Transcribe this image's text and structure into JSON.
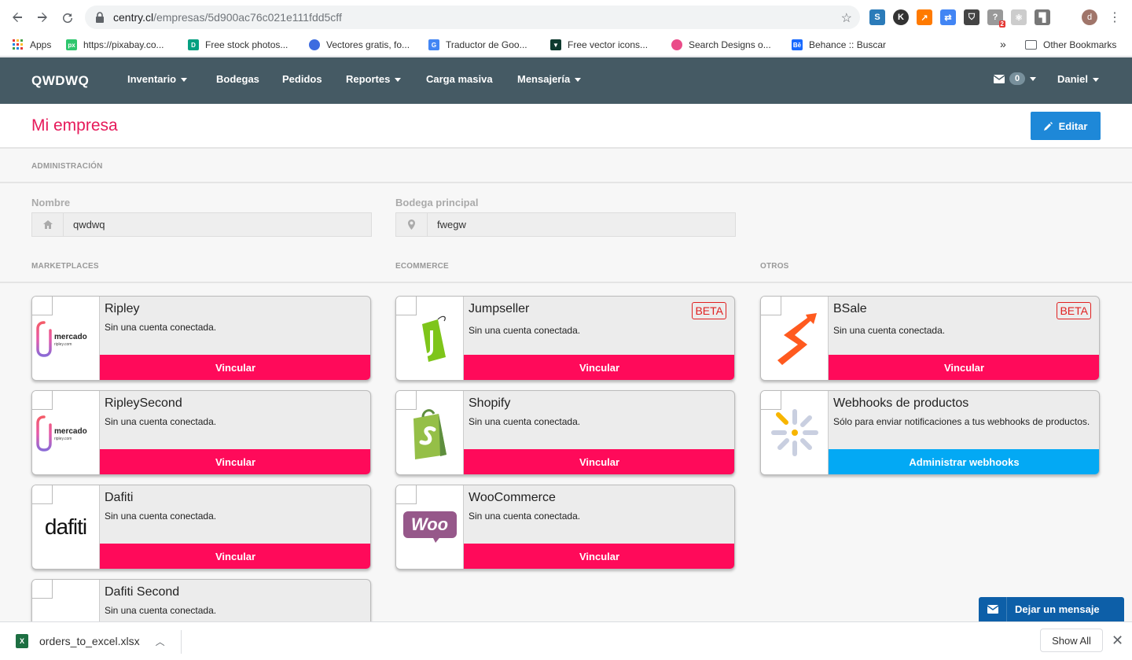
{
  "browser": {
    "url_host": "centry.cl",
    "url_path": "/empresas/5d900ac76c021e111fdd5cff",
    "profile_initial": "d",
    "ext_badge": "2"
  },
  "bookmarks": [
    {
      "label": "Apps",
      "color": "#e53935"
    },
    {
      "label": "https://pixabay.co...",
      "color": "#2ec66d",
      "icon_text": "px"
    },
    {
      "label": "Free stock photos...",
      "color": "#05a081",
      "icon_text": "D"
    },
    {
      "label": "Vectores gratis, fo...",
      "color": "#3d6ce0"
    },
    {
      "label": "Traductor de Goo...",
      "color": "#4285f4"
    },
    {
      "label": "Free vector icons...",
      "color": "#0e3a2f"
    },
    {
      "label": "Search Designs o...",
      "color": "#ea4c89"
    },
    {
      "label": "Behance :: Buscar",
      "color": "#1769ff",
      "icon_text": "Bē"
    }
  ],
  "bookmarks_overflow": "»",
  "other_bookmarks": "Other Bookmarks",
  "navbar": {
    "brand": "QWDWQ",
    "items": [
      "Inventario",
      "Bodegas",
      "Pedidos",
      "Reportes",
      "Carga masiva",
      "Mensajería"
    ],
    "mail_count": "0",
    "user": "Daniel"
  },
  "header": {
    "title": "Mi empresa",
    "edit_label": "Editar"
  },
  "sections": {
    "admin": "ADMINISTRACIÓN",
    "marketplaces": "MARKETPLACES",
    "ecommerce": "ECOMMERCE",
    "otros": "OTROS"
  },
  "form": {
    "nombre_label": "Nombre",
    "nombre_value": "qwdwq",
    "bodega_label": "Bodega principal",
    "bodega_value": "fwegw"
  },
  "cards": {
    "ripley": {
      "name": "Ripley",
      "desc": "Sin una cuenta conectada.",
      "action": "Vincular"
    },
    "ripley_second": {
      "name": "RipleySecond",
      "desc": "Sin una cuenta conectada.",
      "action": "Vincular"
    },
    "dafiti": {
      "name": "Dafiti",
      "desc": "Sin una cuenta conectada.",
      "action": "Vincular"
    },
    "dafiti_second": {
      "name": "Dafiti Second",
      "desc": "Sin una cuenta conectada."
    },
    "jumpseller": {
      "name": "Jumpseller",
      "desc": "Sin una cuenta conectada.",
      "action": "Vincular",
      "badge": "BETA"
    },
    "shopify": {
      "name": "Shopify",
      "desc": "Sin una cuenta conectada.",
      "action": "Vincular"
    },
    "woocommerce": {
      "name": "WooCommerce",
      "desc": "Sin una cuenta conectada.",
      "action": "Vincular"
    },
    "bsale": {
      "name": "BSale",
      "desc": "Sin una cuenta conectada.",
      "action": "Vincular",
      "badge": "BETA"
    },
    "webhooks": {
      "name": "Webhooks de productos",
      "desc": "Sólo para enviar notificaciones a tus webhooks de productos.",
      "action": "Administrar webhooks"
    }
  },
  "logos": {
    "mercado": "mercado",
    "ripley_small": "ripley.com",
    "dafiti": "dafiti",
    "woo": "Woo"
  },
  "message_button": "Dejar un mensaje",
  "downloads": {
    "file": "orders_to_excel.xlsx",
    "show_all": "Show All"
  }
}
